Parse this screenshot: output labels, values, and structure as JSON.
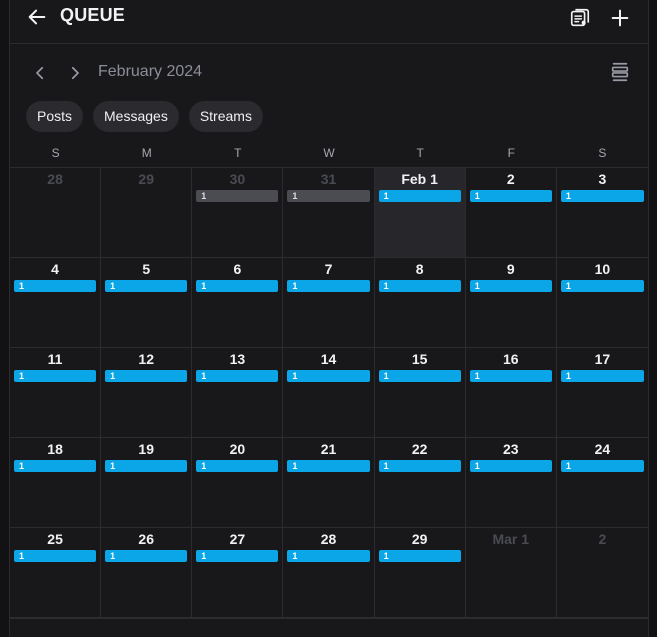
{
  "header": {
    "title": "QUEUE"
  },
  "nav": {
    "month_label": "February 2024"
  },
  "chips": [
    {
      "label": "Posts"
    },
    {
      "label": "Messages"
    },
    {
      "label": "Streams"
    }
  ],
  "weekdays": [
    "S",
    "M",
    "T",
    "W",
    "T",
    "F",
    "S"
  ],
  "weeks": [
    [
      {
        "label": "28",
        "outside": true,
        "count": null
      },
      {
        "label": "29",
        "outside": true,
        "count": null
      },
      {
        "label": "30",
        "outside": true,
        "count": "1",
        "muted": true
      },
      {
        "label": "31",
        "outside": true,
        "count": "1",
        "muted": true
      },
      {
        "label": "Feb 1",
        "today": true,
        "count": "1"
      },
      {
        "label": "2",
        "count": "1"
      },
      {
        "label": "3",
        "count": "1"
      }
    ],
    [
      {
        "label": "4",
        "count": "1"
      },
      {
        "label": "5",
        "count": "1"
      },
      {
        "label": "6",
        "count": "1"
      },
      {
        "label": "7",
        "count": "1"
      },
      {
        "label": "8",
        "count": "1"
      },
      {
        "label": "9",
        "count": "1"
      },
      {
        "label": "10",
        "count": "1"
      }
    ],
    [
      {
        "label": "11",
        "count": "1"
      },
      {
        "label": "12",
        "count": "1"
      },
      {
        "label": "13",
        "count": "1"
      },
      {
        "label": "14",
        "count": "1"
      },
      {
        "label": "15",
        "count": "1"
      },
      {
        "label": "16",
        "count": "1"
      },
      {
        "label": "17",
        "count": "1"
      }
    ],
    [
      {
        "label": "18",
        "count": "1"
      },
      {
        "label": "19",
        "count": "1"
      },
      {
        "label": "20",
        "count": "1"
      },
      {
        "label": "21",
        "count": "1"
      },
      {
        "label": "22",
        "count": "1"
      },
      {
        "label": "23",
        "count": "1"
      },
      {
        "label": "24",
        "count": "1"
      }
    ],
    [
      {
        "label": "25",
        "count": "1"
      },
      {
        "label": "26",
        "count": "1"
      },
      {
        "label": "27",
        "count": "1"
      },
      {
        "label": "28",
        "count": "1"
      },
      {
        "label": "29",
        "count": "1"
      },
      {
        "label": "Mar 1",
        "outside": true,
        "count": null
      },
      {
        "label": "2",
        "outside": true,
        "count": null
      }
    ]
  ],
  "icons": {
    "back": "arrow-left-icon",
    "queue_list": "queue-list-icon",
    "add": "plus-icon",
    "prev": "chevron-left-icon",
    "next": "chevron-right-icon",
    "view_toggle": "view-toggle-icon"
  },
  "colors": {
    "accent": "#0aa6e8",
    "muted_bar": "#4b4c52",
    "background": "#18181b",
    "today": "#26262b"
  }
}
